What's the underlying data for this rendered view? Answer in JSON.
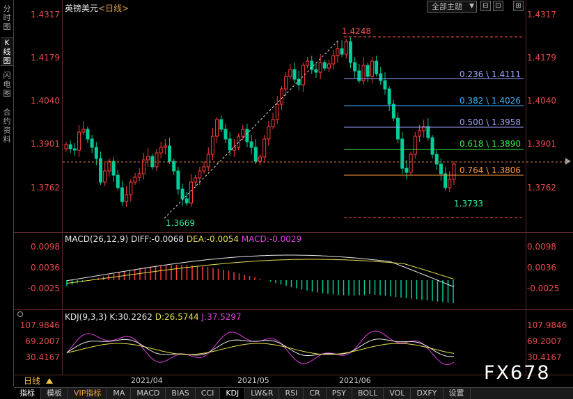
{
  "sidebar": {
    "tabs": [
      {
        "label": "分时图"
      },
      {
        "label": "K线图"
      },
      {
        "label": "闪电图"
      },
      {
        "label": "合约资料"
      }
    ]
  },
  "header": {
    "symbol": "英镑美元",
    "timeframe": "<日线>",
    "theme_select": "全部主题",
    "theme_arrow": "▼",
    "window_buttons": [
      "⊟",
      "⊡",
      "⊞"
    ]
  },
  "price_axis": {
    "labels": [
      "1.4317",
      "1.4179",
      "1.4040",
      "1.3901",
      "1.3762"
    ]
  },
  "annotations": {
    "high": "1.4248",
    "low_left": "1.3669",
    "low_right": "1.3733"
  },
  "fibonacci": [
    {
      "label": "0.236 \\ 1.4111",
      "color": "#9aa8ff"
    },
    {
      "label": "0.382 \\ 1.4026",
      "color": "#3fb6ff"
    },
    {
      "label": "0.500 \\ 1.3958",
      "color": "#a0a0ff"
    },
    {
      "label": "0.618 \\ 1.3890",
      "color": "#33ee44"
    },
    {
      "label": "0.764 \\ 1.3806",
      "color": "#ff9a40"
    }
  ],
  "macd": {
    "title": "MACD(26,12,9)",
    "diff": "DIFF:-0.0068",
    "dea": "DEA:-0.0054",
    "macd": "MACD:-0.0029",
    "axis_labels": [
      "0.0098",
      "0.0036",
      "-0.0025"
    ]
  },
  "kdj": {
    "title": "KDJ(9,3,3)",
    "k": "K:30.2262",
    "d": "D:26.5744",
    "j": "J:37.5297",
    "axis_labels": [
      "107.9846",
      "69.2007",
      "30.4167"
    ]
  },
  "x_axis": {
    "labels": [
      "2021/04",
      "2021/05",
      "2021/06"
    ]
  },
  "period_button": "日线",
  "bottom_tabs": [
    "指标",
    "模板",
    "VIP指标",
    "MA",
    "MACD",
    "BIAS",
    "CCI",
    "KDJ",
    "LW&R",
    "RSI",
    "CR",
    "PSY",
    "BOLL",
    "VOL",
    "DXFY",
    "设置"
  ],
  "watermark": "FX678",
  "colors": {
    "up": "#ff3c3c",
    "down": "#00cc99",
    "axis": "#e34b4b"
  }
}
